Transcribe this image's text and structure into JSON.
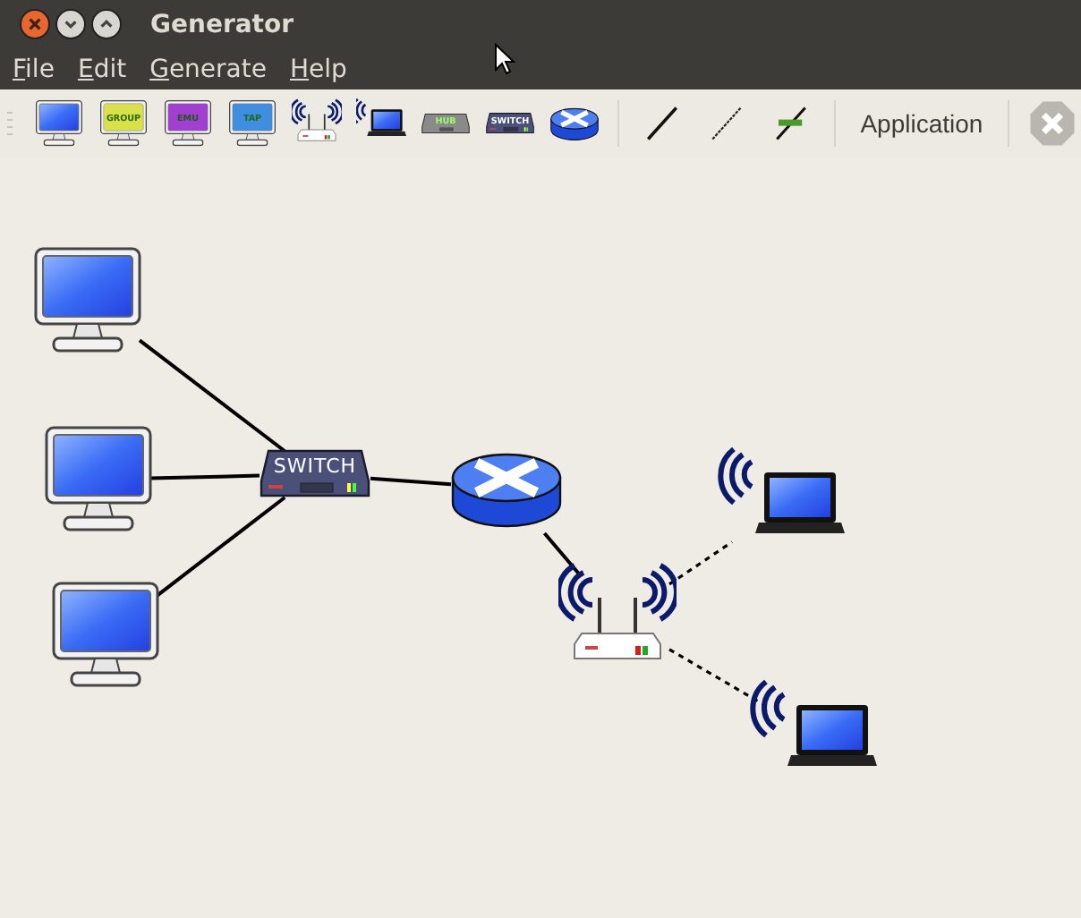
{
  "window": {
    "title": "Generator"
  },
  "menu": [
    {
      "label": "File"
    },
    {
      "label": "Edit"
    },
    {
      "label": "Generate"
    },
    {
      "label": "Help"
    }
  ],
  "toolbar": [
    {
      "kind": "computer"
    },
    {
      "kind": "group",
      "label": "GROUP"
    },
    {
      "kind": "emu",
      "label": "EMU"
    },
    {
      "kind": "tap",
      "label": "TAP"
    },
    {
      "kind": "access-point"
    },
    {
      "kind": "laptop"
    },
    {
      "kind": "hub",
      "label": "HUB"
    },
    {
      "kind": "switch",
      "label": "SWITCH"
    },
    {
      "kind": "router"
    },
    {
      "kind": "separator"
    },
    {
      "kind": "link"
    },
    {
      "kind": "wireless-link"
    },
    {
      "kind": "rj45-link"
    },
    {
      "kind": "separator"
    },
    {
      "kind": "text",
      "label": "Application"
    },
    {
      "kind": "separator"
    },
    {
      "kind": "stop",
      "disabled": true
    }
  ],
  "canvas": {
    "nodes": [
      {
        "kind": "computer"
      },
      {
        "kind": "computer"
      },
      {
        "kind": "computer"
      },
      {
        "kind": "switch",
        "label": "SWITCH"
      },
      {
        "kind": "router"
      },
      {
        "kind": "access-point"
      },
      {
        "kind": "laptop"
      },
      {
        "kind": "laptop"
      }
    ],
    "links": [
      {
        "kind": "wired"
      },
      {
        "kind": "wired"
      },
      {
        "kind": "wired"
      },
      {
        "kind": "wired"
      },
      {
        "kind": "wired"
      },
      {
        "kind": "wireless"
      },
      {
        "kind": "wireless"
      }
    ]
  }
}
